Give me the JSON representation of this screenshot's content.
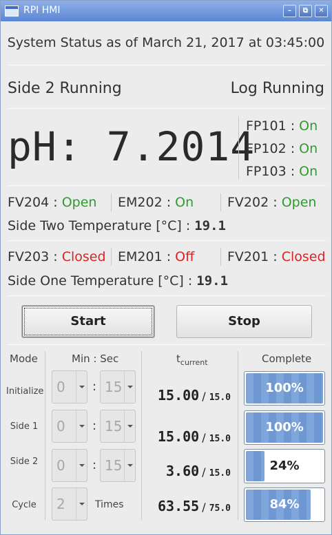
{
  "window": {
    "title": "RPI HMI",
    "min": "–",
    "max": "⧉",
    "close": "✕"
  },
  "status": "System Status as of March 21, 2017 at 03:45:00",
  "side_status": "Side 2 Running",
  "log_status": "Log Running",
  "ph": {
    "label": "pH:",
    "value": "7.2014"
  },
  "fp": [
    {
      "name": "FP101 :",
      "state": "On"
    },
    {
      "name": "FP102 :",
      "state": "On"
    },
    {
      "name": "FP103 :",
      "state": "On"
    }
  ],
  "side_two": {
    "valves": [
      {
        "name": "FV204 :",
        "state": "Open"
      },
      {
        "name": "EM202 :",
        "state": "On"
      },
      {
        "name": "FV202 :",
        "state": "Open"
      }
    ],
    "temp_label": "Side Two Temperature [°C] :",
    "temp_value": "19.1"
  },
  "side_one": {
    "valves": [
      {
        "name": "FV203 :",
        "state": "Closed"
      },
      {
        "name": "EM201 :",
        "state": "Off"
      },
      {
        "name": "FV201 :",
        "state": "Closed"
      }
    ],
    "temp_label": "Side One Temperature [°C] :",
    "temp_value": "19.1"
  },
  "buttons": {
    "start": "Start",
    "stop": "Stop"
  },
  "table": {
    "headers": {
      "mode": "Mode",
      "minsec": "Min : Sec",
      "t": "t",
      "t_sub": "current",
      "complete": "Complete"
    },
    "colon": ":",
    "times_label": "Times",
    "rows": [
      {
        "mode": "Initialize",
        "min": "0",
        "sec": "15",
        "t": "15.00",
        "tmax": "15.0",
        "progress": 100,
        "label": "100%"
      },
      {
        "mode": "Side 1",
        "min": "0",
        "sec": "15",
        "t": "15.00",
        "tmax": "15.0",
        "progress": 100,
        "label": "100%"
      },
      {
        "mode": "Side 2",
        "min": "0",
        "sec": "15",
        "t": "3.60",
        "tmax": "15.0",
        "progress": 24,
        "label": "24%"
      },
      {
        "mode": "Cycle",
        "min": "2",
        "t": "63.55",
        "tmax": "75.0",
        "progress": 84,
        "label": "84%"
      }
    ]
  },
  "colors": {
    "on": "#2f9a2f",
    "off": "#e02020",
    "progress": "#7fa6db"
  }
}
